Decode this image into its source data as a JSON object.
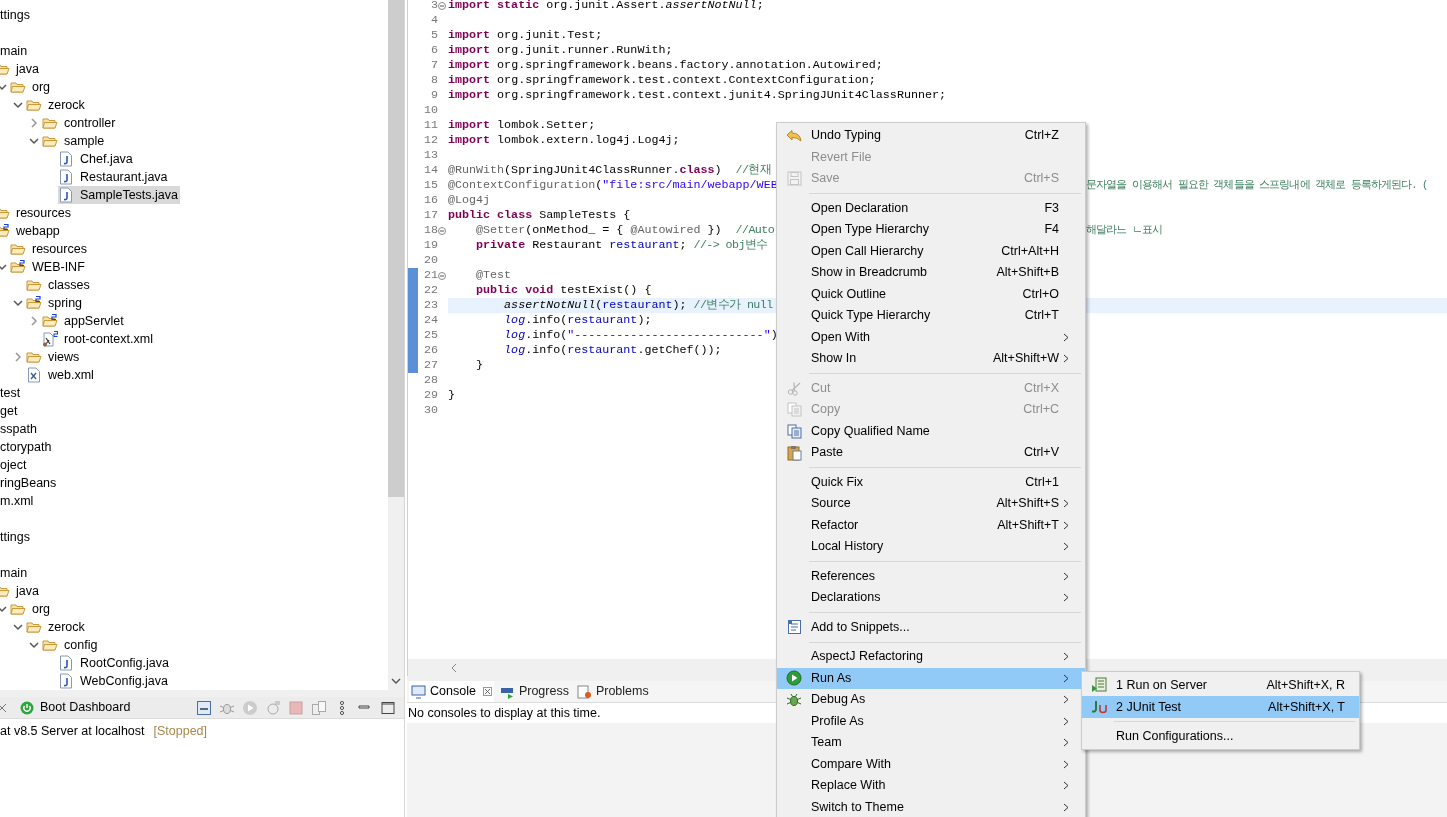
{
  "explorer": {
    "tree": [
      {
        "kind": "text",
        "text": "ttings",
        "selected": false
      },
      {
        "kind": "clipped"
      },
      {
        "kind": "text",
        "text": "main",
        "selected": false,
        "children": [
          {
            "kind": "folder",
            "text": "java",
            "selected": false,
            "children": [
              {
                "kind": "folder",
                "text": "org",
                "expanded": true,
                "selected": false,
                "children": [
                  {
                    "kind": "folder",
                    "text": "zerock",
                    "expanded": true,
                    "selected": false,
                    "children": [
                      {
                        "kind": "folder",
                        "text": "controller",
                        "expanded": false,
                        "selected": false
                      },
                      {
                        "kind": "folder",
                        "text": "sample",
                        "expanded": true,
                        "selected": false,
                        "children": [
                          {
                            "kind": "java",
                            "text": "Chef.java",
                            "selected": false
                          },
                          {
                            "kind": "java",
                            "text": "Restaurant.java",
                            "selected": false
                          },
                          {
                            "kind": "java",
                            "text": "SampleTests.java",
                            "selected": true
                          }
                        ]
                      }
                    ]
                  }
                ]
              }
            ]
          },
          {
            "kind": "folder",
            "text": "resources",
            "selected": false
          },
          {
            "kind": "spring-folder",
            "text": "webapp",
            "selected": false,
            "children": [
              {
                "kind": "folder",
                "text": "resources",
                "selected": false
              },
              {
                "kind": "spring-folder",
                "text": "WEB-INF",
                "expanded": true,
                "selected": false,
                "children": [
                  {
                    "kind": "folder",
                    "text": "classes",
                    "selected": false
                  },
                  {
                    "kind": "spring-folder",
                    "text": "spring",
                    "expanded": true,
                    "selected": false,
                    "children": [
                      {
                        "kind": "spring-folder",
                        "text": "appServlet",
                        "expanded": false,
                        "selected": false
                      },
                      {
                        "kind": "spring-xml",
                        "text": "root-context.xml",
                        "selected": false
                      }
                    ]
                  },
                  {
                    "kind": "folder",
                    "text": "views",
                    "expanded": false,
                    "selected": false
                  },
                  {
                    "kind": "xml",
                    "text": "web.xml",
                    "selected": false
                  }
                ]
              }
            ]
          }
        ]
      },
      {
        "kind": "text",
        "text": "test",
        "selected": false
      },
      {
        "kind": "text",
        "text": "get",
        "selected": false
      },
      {
        "kind": "text",
        "text": "sspath",
        "selected": false
      },
      {
        "kind": "text",
        "text": "ctorypath",
        "selected": false
      },
      {
        "kind": "text",
        "text": "oject",
        "selected": false
      },
      {
        "kind": "text",
        "text": "ringBeans",
        "selected": false
      },
      {
        "kind": "text",
        "text": "m.xml",
        "selected": false
      },
      {
        "kind": "clipped"
      },
      {
        "kind": "text",
        "text": "ttings",
        "selected": false
      },
      {
        "kind": "clipped"
      },
      {
        "kind": "text",
        "text": "main",
        "selected": false,
        "children": [
          {
            "kind": "folder",
            "text": "java",
            "selected": false,
            "children": [
              {
                "kind": "folder",
                "text": "org",
                "expanded": true,
                "selected": false,
                "children": [
                  {
                    "kind": "folder",
                    "text": "zerock",
                    "expanded": true,
                    "selected": false,
                    "children": [
                      {
                        "kind": "folder",
                        "text": "config",
                        "expanded": true,
                        "selected": false,
                        "children": [
                          {
                            "kind": "java",
                            "text": "RootConfig.java",
                            "selected": false
                          },
                          {
                            "kind": "java",
                            "text": "WebConfig.java",
                            "selected": false
                          }
                        ]
                      }
                    ]
                  }
                ]
              }
            ]
          }
        ]
      }
    ]
  },
  "servers_panel": {
    "tabs": [
      {
        "label": "Boot Dashboard",
        "selected": true
      }
    ],
    "rows": [
      {
        "name": "at v8.5 Server at localhost",
        "status": "[Stopped]"
      }
    ]
  },
  "editor": {
    "lines": [
      {
        "no": "3",
        "fold": true,
        "changed": false,
        "current": false,
        "tokens": [
          {
            "kind": "keyword",
            "text": "import static"
          },
          {
            "kind": "plain",
            "text": " org.junit.Assert."
          },
          {
            "kind": "static",
            "text": "assertNotNull"
          },
          {
            "kind": "plain",
            "text": ";"
          }
        ]
      },
      {
        "no": "4",
        "fold": false,
        "changed": false,
        "current": false
      },
      {
        "no": "5",
        "fold": false,
        "changed": false,
        "current": false,
        "tokens": [
          {
            "kind": "keyword",
            "text": "import"
          },
          {
            "kind": "plain",
            "text": " org.junit.Test;"
          }
        ]
      },
      {
        "no": "6",
        "fold": false,
        "changed": false,
        "current": false,
        "tokens": [
          {
            "kind": "keyword",
            "text": "import"
          },
          {
            "kind": "plain",
            "text": " org.junit.runner.RunWith;"
          }
        ]
      },
      {
        "no": "7",
        "fold": false,
        "changed": false,
        "current": false,
        "tokens": [
          {
            "kind": "keyword",
            "text": "import"
          },
          {
            "kind": "plain",
            "text": " org.springframework.beans.factory.annotation.Autowired;"
          }
        ]
      },
      {
        "no": "8",
        "fold": false,
        "changed": false,
        "current": false,
        "tokens": [
          {
            "kind": "keyword",
            "text": "import"
          },
          {
            "kind": "plain",
            "text": " org.springframework.test.context.ContextConfiguration;"
          }
        ]
      },
      {
        "no": "9",
        "fold": false,
        "changed": false,
        "current": false,
        "tokens": [
          {
            "kind": "keyword",
            "text": "import"
          },
          {
            "kind": "plain",
            "text": " org.springframework.test.context.junit4.SpringJUnit4ClassRunner;"
          }
        ]
      },
      {
        "no": "10",
        "fold": false,
        "changed": false,
        "current": false
      },
      {
        "no": "11",
        "fold": false,
        "changed": false,
        "current": false,
        "tokens": [
          {
            "kind": "keyword",
            "text": "import"
          },
          {
            "kind": "plain",
            "text": " lombok.Setter;"
          }
        ]
      },
      {
        "no": "12",
        "fold": false,
        "changed": false,
        "current": false,
        "tokens": [
          {
            "kind": "keyword",
            "text": "import"
          },
          {
            "kind": "plain",
            "text": " lombok.extern.log4j.Log4j;"
          }
        ]
      },
      {
        "no": "13",
        "fold": false,
        "changed": false,
        "current": false
      },
      {
        "no": "14",
        "fold": false,
        "changed": false,
        "current": false,
        "tokens": [
          {
            "kind": "annotation",
            "text": "@RunWith"
          },
          {
            "kind": "plain",
            "text": "(SpringJUnit4ClassRunner."
          },
          {
            "kind": "keyword",
            "text": "class"
          },
          {
            "kind": "plain",
            "text": ")  "
          },
          {
            "kind": "comment",
            "text": "//현재"
          }
        ]
      },
      {
        "no": "15",
        "fold": false,
        "changed": false,
        "current": false,
        "tokens": [
          {
            "kind": "annotation",
            "text": "@ContextConfiguration"
          },
          {
            "kind": "plain",
            "text": "("
          },
          {
            "kind": "string",
            "text": "\"file:src/main/webapp/WEB"
          }
        ],
        "right": "문자열을 이용해서 필요한 객체들을 스프링내에 객체로 등록하게된다. ("
      },
      {
        "no": "16",
        "fold": false,
        "changed": false,
        "current": false,
        "tokens": [
          {
            "kind": "annotation",
            "text": "@Log4j"
          }
        ]
      },
      {
        "no": "17",
        "fold": false,
        "changed": false,
        "current": false,
        "tokens": [
          {
            "kind": "keyword",
            "text": "public class"
          },
          {
            "kind": "plain",
            "text": " SampleTests {"
          }
        ]
      },
      {
        "no": "18",
        "fold": true,
        "changed": false,
        "current": false,
        "tokens": [
          {
            "kind": "annotation",
            "text": "    @Setter"
          },
          {
            "kind": "plain",
            "text": "(onMethod_ = { "
          },
          {
            "kind": "annotation",
            "text": "@Autowired"
          },
          {
            "kind": "plain",
            "text": " })  "
          },
          {
            "kind": "comment",
            "text": "//Auto"
          }
        ],
        "right": "해달라느 ㄴ표시"
      },
      {
        "no": "19",
        "fold": false,
        "changed": false,
        "current": false,
        "tokens": [
          {
            "kind": "keyword",
            "text": "    private"
          },
          {
            "kind": "plain",
            "text": " Restaurant "
          },
          {
            "kind": "field",
            "text": "restaurant"
          },
          {
            "kind": "plain",
            "text": "; "
          },
          {
            "kind": "comment",
            "text": "//-> obj변수"
          }
        ]
      },
      {
        "no": "20",
        "fold": false,
        "changed": false,
        "current": false
      },
      {
        "no": "21",
        "fold": true,
        "changed": true,
        "current": false,
        "tokens": [
          {
            "kind": "annotation",
            "text": "    @Test"
          }
        ]
      },
      {
        "no": "22",
        "fold": false,
        "changed": true,
        "current": false,
        "tokens": [
          {
            "kind": "keyword",
            "text": "    public void"
          },
          {
            "kind": "plain",
            "text": " testExist() {"
          }
        ]
      },
      {
        "no": "23",
        "fold": false,
        "changed": true,
        "current": true,
        "tokens": [
          {
            "kind": "static",
            "text": "        assertNotNull"
          },
          {
            "kind": "plain",
            "text": "("
          },
          {
            "kind": "field",
            "text": "restaurant"
          },
          {
            "kind": "plain",
            "text": "); "
          },
          {
            "kind": "comment",
            "text": "//변수가 null"
          }
        ]
      },
      {
        "no": "24",
        "fold": false,
        "changed": true,
        "current": false,
        "tokens": [
          {
            "kind": "static-field",
            "text": "        log"
          },
          {
            "kind": "plain",
            "text": ".info("
          },
          {
            "kind": "field",
            "text": "restaurant"
          },
          {
            "kind": "plain",
            "text": ");"
          }
        ]
      },
      {
        "no": "25",
        "fold": false,
        "changed": true,
        "current": false,
        "tokens": [
          {
            "kind": "static-field",
            "text": "        log"
          },
          {
            "kind": "plain",
            "text": ".info("
          },
          {
            "kind": "string",
            "text": "\"---------------------------\""
          },
          {
            "kind": "plain",
            "text": ")"
          }
        ]
      },
      {
        "no": "26",
        "fold": false,
        "changed": true,
        "current": false,
        "tokens": [
          {
            "kind": "static-field",
            "text": "        log"
          },
          {
            "kind": "plain",
            "text": ".info("
          },
          {
            "kind": "field",
            "text": "restaurant"
          },
          {
            "kind": "plain",
            "text": ".getChef());"
          }
        ]
      },
      {
        "no": "27",
        "fold": false,
        "changed": true,
        "current": false,
        "tokens": [
          {
            "kind": "plain",
            "text": "    }"
          }
        ]
      },
      {
        "no": "28",
        "fold": false,
        "changed": false,
        "current": false
      },
      {
        "no": "29",
        "fold": false,
        "changed": false,
        "current": false,
        "tokens": [
          {
            "kind": "plain",
            "text": "}"
          }
        ]
      },
      {
        "no": "30",
        "fold": false,
        "changed": false,
        "current": false
      }
    ]
  },
  "console_panel": {
    "tabs": [
      {
        "label": "Console",
        "selected": true,
        "closable": true
      },
      {
        "label": "Progress",
        "selected": false,
        "closable": false
      },
      {
        "label": "Problems",
        "selected": false,
        "closable": false
      }
    ],
    "message": "No consoles to display at this time."
  },
  "context_menu": {
    "items": [
      {
        "kind": "item",
        "label": "Undo Typing",
        "shortcut": "Ctrl+Z",
        "disabled": false,
        "submenu": false,
        "selected": false
      },
      {
        "kind": "item",
        "label": "Revert File",
        "disabled": true,
        "submenu": false,
        "selected": false
      },
      {
        "kind": "item",
        "label": "Save",
        "shortcut": "Ctrl+S",
        "disabled": true,
        "submenu": false,
        "selected": false
      },
      {
        "kind": "separator"
      },
      {
        "kind": "item",
        "label": "Open Declaration",
        "shortcut": "F3",
        "disabled": false,
        "submenu": false,
        "selected": false
      },
      {
        "kind": "item",
        "label": "Open Type Hierarchy",
        "shortcut": "F4",
        "disabled": false,
        "submenu": false,
        "selected": false
      },
      {
        "kind": "item",
        "label": "Open Call Hierarchy",
        "shortcut": "Ctrl+Alt+H",
        "disabled": false,
        "submenu": false,
        "selected": false
      },
      {
        "kind": "item",
        "label": "Show in Breadcrumb",
        "shortcut": "Alt+Shift+B",
        "disabled": false,
        "submenu": false,
        "selected": false
      },
      {
        "kind": "item",
        "label": "Quick Outline",
        "shortcut": "Ctrl+O",
        "disabled": false,
        "submenu": false,
        "selected": false
      },
      {
        "kind": "item",
        "label": "Quick Type Hierarchy",
        "shortcut": "Ctrl+T",
        "disabled": false,
        "submenu": false,
        "selected": false
      },
      {
        "kind": "item",
        "label": "Open With",
        "disabled": false,
        "submenu": true,
        "selected": false
      },
      {
        "kind": "item",
        "label": "Show In",
        "shortcut": "Alt+Shift+W",
        "disabled": false,
        "submenu": true,
        "selected": false
      },
      {
        "kind": "separator"
      },
      {
        "kind": "item",
        "label": "Cut",
        "shortcut": "Ctrl+X",
        "disabled": true,
        "submenu": false,
        "selected": false
      },
      {
        "kind": "item",
        "label": "Copy",
        "shortcut": "Ctrl+C",
        "disabled": true,
        "submenu": false,
        "selected": false
      },
      {
        "kind": "item",
        "label": "Copy Qualified Name",
        "disabled": false,
        "submenu": false,
        "selected": false
      },
      {
        "kind": "item",
        "label": "Paste",
        "shortcut": "Ctrl+V",
        "disabled": false,
        "submenu": false,
        "selected": false
      },
      {
        "kind": "separator"
      },
      {
        "kind": "item",
        "label": "Quick Fix",
        "shortcut": "Ctrl+1",
        "disabled": false,
        "submenu": false,
        "selected": false
      },
      {
        "kind": "item",
        "label": "Source",
        "shortcut": "Alt+Shift+S",
        "disabled": false,
        "submenu": true,
        "selected": false
      },
      {
        "kind": "item",
        "label": "Refactor",
        "shortcut": "Alt+Shift+T",
        "disabled": false,
        "submenu": true,
        "selected": false
      },
      {
        "kind": "item",
        "label": "Local History",
        "disabled": false,
        "submenu": true,
        "selected": false
      },
      {
        "kind": "separator"
      },
      {
        "kind": "item",
        "label": "References",
        "disabled": false,
        "submenu": true,
        "selected": false
      },
      {
        "kind": "item",
        "label": "Declarations",
        "disabled": false,
        "submenu": true,
        "selected": false
      },
      {
        "kind": "separator"
      },
      {
        "kind": "item",
        "label": "Add to Snippets...",
        "disabled": false,
        "submenu": false,
        "selected": false
      },
      {
        "kind": "separator"
      },
      {
        "kind": "item",
        "label": "AspectJ Refactoring",
        "disabled": false,
        "submenu": true,
        "selected": false
      },
      {
        "kind": "item",
        "label": "Run As",
        "disabled": false,
        "submenu": true,
        "selected": true
      },
      {
        "kind": "item",
        "label": "Debug As",
        "disabled": false,
        "submenu": true,
        "selected": false
      },
      {
        "kind": "item",
        "label": "Profile As",
        "disabled": false,
        "submenu": true,
        "selected": false
      },
      {
        "kind": "item",
        "label": "Team",
        "disabled": false,
        "submenu": true,
        "selected": false
      },
      {
        "kind": "item",
        "label": "Compare With",
        "disabled": false,
        "submenu": true,
        "selected": false
      },
      {
        "kind": "item",
        "label": "Replace With",
        "disabled": false,
        "submenu": true,
        "selected": false
      },
      {
        "kind": "item",
        "label": "Switch to Theme",
        "disabled": false,
        "submenu": true,
        "selected": false
      }
    ]
  },
  "run_as_submenu": {
    "items": [
      {
        "kind": "item",
        "label": "1 Run on Server",
        "shortcut": "Alt+Shift+X, R",
        "selected": false
      },
      {
        "kind": "item",
        "label": "2 JUnit Test",
        "shortcut": "Alt+Shift+X, T",
        "selected": true
      },
      {
        "kind": "separator"
      },
      {
        "kind": "item",
        "label": "Run Configurations...",
        "selected": false
      }
    ]
  }
}
